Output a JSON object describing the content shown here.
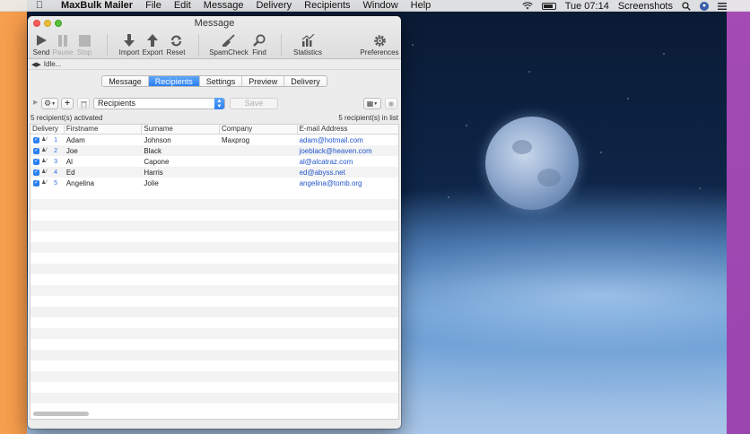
{
  "menubar": {
    "app_name": "MaxBulk Mailer",
    "items": [
      "File",
      "Edit",
      "Message",
      "Delivery",
      "Recipients",
      "Window",
      "Help"
    ],
    "clock": "Tue 07:14",
    "screenshots": "Screenshots"
  },
  "window": {
    "title": "Message",
    "status": "Idle...",
    "toolbar": {
      "send": "Send",
      "pause": "Pause",
      "stop": "Stop",
      "import": "Import",
      "export": "Export",
      "reset": "Reset",
      "spamcheck": "SpamCheck",
      "find": "Find",
      "statistics": "Statistics",
      "preferences": "Preferences"
    },
    "tabs": [
      "Message",
      "Recipients",
      "Settings",
      "Preview",
      "Delivery"
    ],
    "active_tab": "Recipients",
    "list_popup": "Recipients",
    "save_label": "Save",
    "activated_info": "5 recipient(s) activated",
    "list_info": "5 recipient(s) in list",
    "columns": [
      "Delivery",
      "Firstname",
      "Surname",
      "Company",
      "E-mail Address"
    ],
    "rows": [
      {
        "num": "1",
        "first": "Adam",
        "sur": "Johnson",
        "company": "Maxprog",
        "email": "adam@hotmail.com"
      },
      {
        "num": "2",
        "first": "Joe",
        "sur": "Black",
        "company": "",
        "email": "joeblack@heaven.com"
      },
      {
        "num": "3",
        "first": "Al",
        "sur": "Capone",
        "company": "",
        "email": "al@alcatraz.com"
      },
      {
        "num": "4",
        "first": "Ed",
        "sur": "Harris",
        "company": "",
        "email": "ed@abyss.net"
      },
      {
        "num": "5",
        "first": "Angelina",
        "sur": "Jolie",
        "company": "",
        "email": "angelina@tomb.org"
      }
    ]
  },
  "colors": {
    "accent": "#2b7ff0",
    "link": "#2255cc"
  }
}
